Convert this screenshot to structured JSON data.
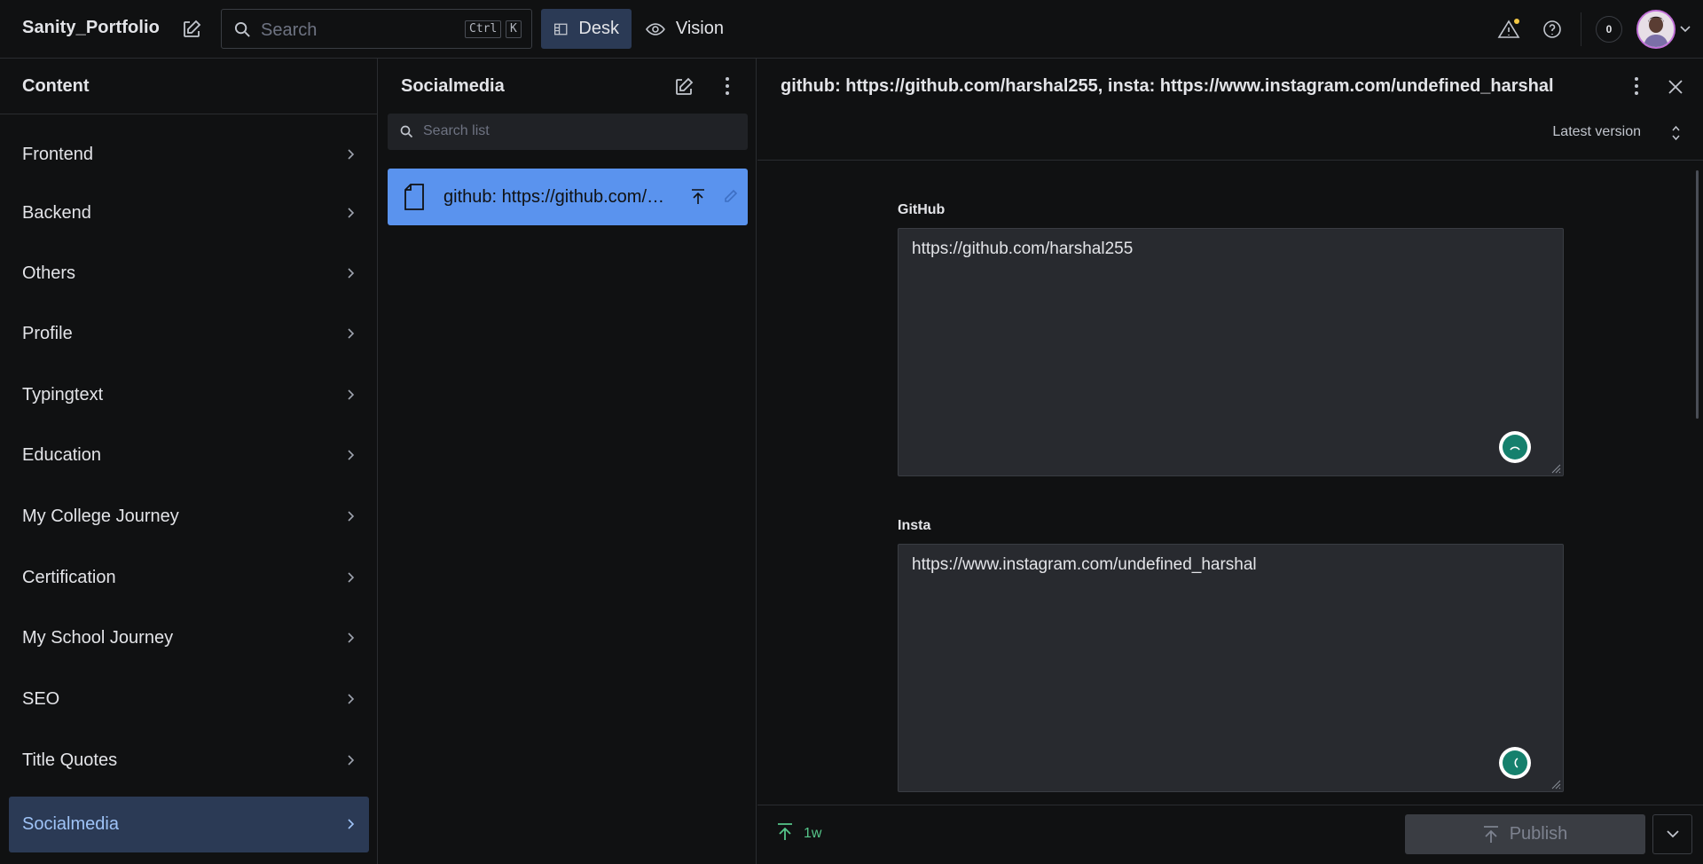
{
  "topbar": {
    "brand": "Sanity_Portfolio",
    "search_placeholder": "Search",
    "kbd_ctrl": "Ctrl",
    "kbd_k": "K",
    "nav": [
      {
        "label": "Desk",
        "icon": "desk-icon",
        "active": true
      },
      {
        "label": "Vision",
        "icon": "eye-icon",
        "active": false
      }
    ],
    "notification_count": "0"
  },
  "content_pane": {
    "title": "Content",
    "items": [
      {
        "label": "Frontend"
      },
      {
        "label": "Backend"
      },
      {
        "label": "Others"
      },
      {
        "label": "Profile"
      },
      {
        "label": "Typingtext"
      },
      {
        "label": "Education"
      },
      {
        "label": "My College Journey"
      },
      {
        "label": "Certification"
      },
      {
        "label": "My School Journey"
      },
      {
        "label": "SEO"
      },
      {
        "label": "Title Quotes"
      },
      {
        "label": "Socialmedia",
        "selected": true
      }
    ]
  },
  "list_pane": {
    "title": "Socialmedia",
    "search_placeholder": "Search list",
    "documents": [
      {
        "label": "github: https://github.com/harshal255, insta: https://www.instagram.com/undefined_harshal"
      }
    ]
  },
  "document": {
    "title": "github: https://github.com/harshal255, insta: https://www.instagram.com/undefined_harshal",
    "version_label": "Latest version",
    "fields": [
      {
        "label": "GitHub",
        "value": "https://github.com/harshal255"
      },
      {
        "label": "Insta",
        "value": "https://www.instagram.com/undefined_harshal"
      }
    ],
    "footer": {
      "published_ago": "1w",
      "publish_label": "Publish"
    }
  },
  "colors": {
    "background": "#101112",
    "accent_selected": "#2b3a55",
    "document_selected": "#5a93ee",
    "published_green": "#56c68a",
    "avatar_ring": "#c270d8"
  }
}
